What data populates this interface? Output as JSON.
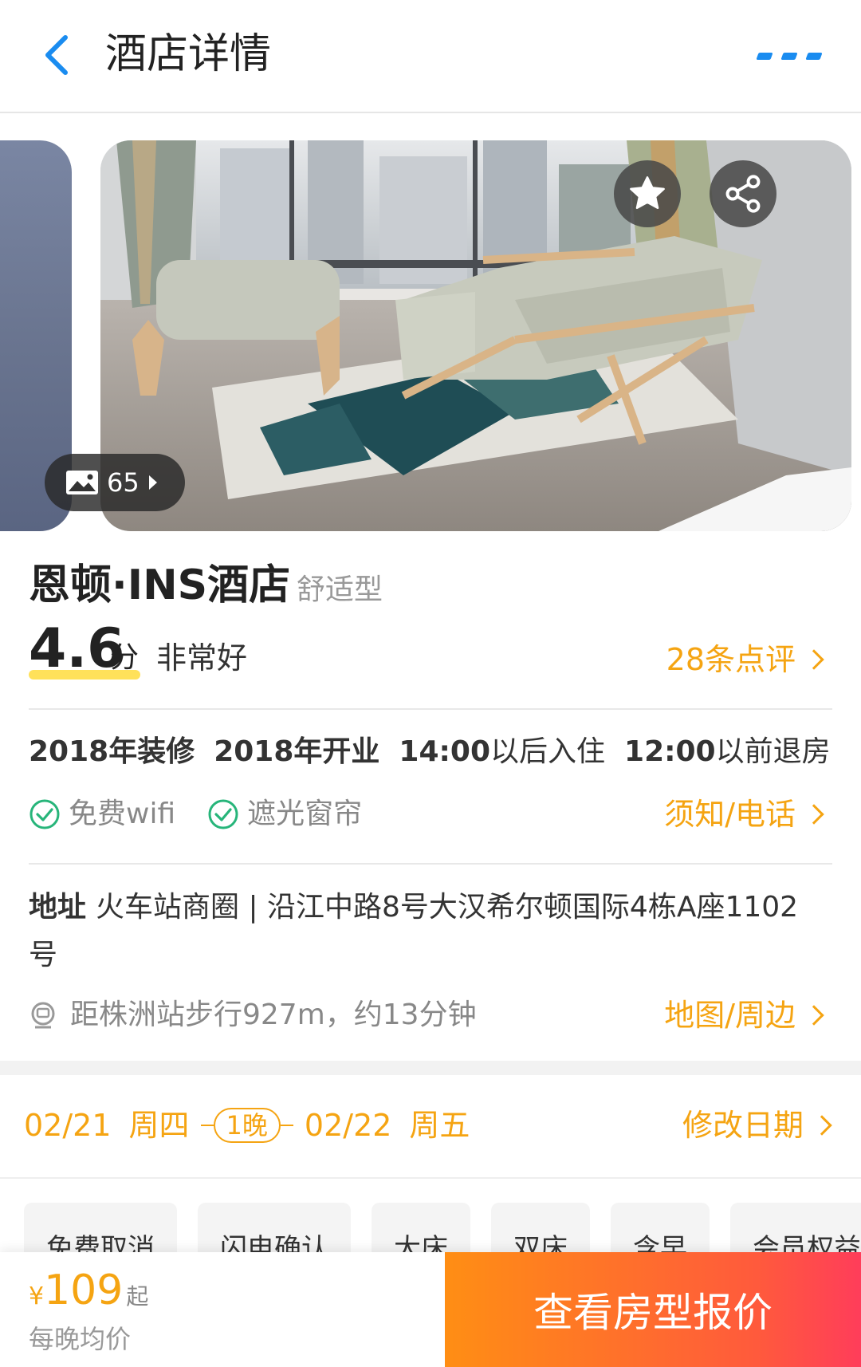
{
  "header": {
    "title": "酒店详情",
    "back_icon": "chevron-left-icon",
    "more_icon": "more-icon",
    "accent_color": "#1a8cf0"
  },
  "gallery": {
    "photo_count": "65",
    "photo_icon": "image-icon",
    "favorite_icon": "star-icon",
    "share_icon": "share-icon"
  },
  "hotel": {
    "name": "恩顿·INS酒店",
    "type": "舒适型",
    "score": "4.6",
    "score_unit": "分",
    "score_desc": "非常好",
    "reviews_link": "28条点评",
    "renovated": "2018年装修",
    "opened": "2018年开业",
    "checkin_time": "14:00",
    "checkin_suffix": "以后入住",
    "checkout_time": "12:00",
    "checkout_suffix": "以前退房",
    "amenities": [
      "免费wifi",
      "遮光窗帘"
    ],
    "notice_link": "须知/电话",
    "address_label": "地址",
    "address": "火车站商圈 | 沿江中路8号大汉希尔顿国际4栋A座1102号",
    "transit": "距株洲站步行927m，约13分钟",
    "map_link": "地图/周边",
    "accent_color": "#f5a412"
  },
  "dates": {
    "checkin_date": "02/21",
    "checkin_day": "周四",
    "nights": "1晚",
    "checkout_date": "02/22",
    "checkout_day": "周五",
    "edit_label": "修改日期"
  },
  "chips": [
    "免费取消",
    "闪电确认",
    "大床",
    "双床",
    "含早",
    "会员权益"
  ],
  "bottom": {
    "currency": "¥",
    "price": "109",
    "price_suffix": "起",
    "price_note": "每晚均价",
    "cta_label": "查看房型报价"
  }
}
